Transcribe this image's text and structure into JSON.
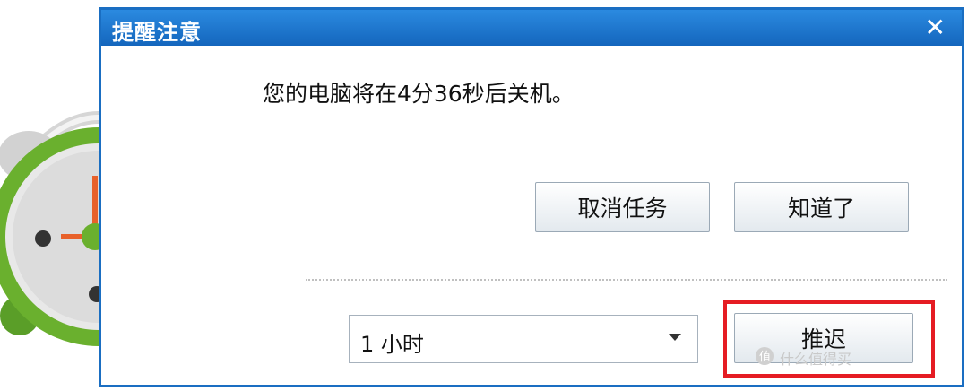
{
  "dialog": {
    "title": "提醒注意",
    "close_symbol": "✕",
    "message": "您的电脑将在4分36秒后关机。",
    "buttons": {
      "cancel_task": "取消任务",
      "acknowledge": "知道了",
      "snooze": "推迟"
    },
    "snooze_select": {
      "selected": "1 小时"
    }
  },
  "watermark": {
    "text": "什么值得买"
  },
  "colors": {
    "titlebar": "#1a6ec2",
    "highlight": "#e51c23",
    "clock_body": "#6ab02e",
    "power_badge": "#e04e12"
  },
  "icons": [
    "alarm-clock-icon",
    "power-icon",
    "close-icon",
    "dropdown-arrow-icon"
  ]
}
